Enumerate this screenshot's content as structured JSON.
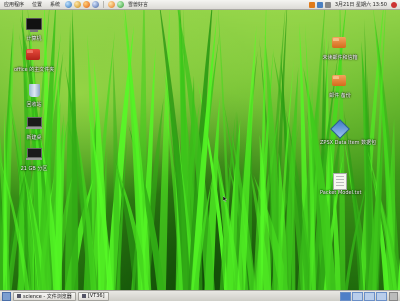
{
  "top_panel": {
    "menus": [
      "应用程序",
      "位置",
      "系统"
    ],
    "center_text": "雪兽好言",
    "clock": "3月21日 星期六 13:50",
    "launcher_icons": [
      "globe-icon",
      "mail-icon",
      "firefox-icon",
      "help-icon"
    ]
  },
  "desktop": {
    "icons_left": [
      {
        "name": "computer-icon",
        "label": "计算机"
      },
      {
        "name": "folder-icon",
        "label": "office 的主文件夹"
      },
      {
        "name": "trash-icon",
        "label": "回收站"
      },
      {
        "name": "laptop-icon",
        "label": "新建桌"
      },
      {
        "name": "laptop-icon",
        "label": "21 GB 分区"
      }
    ],
    "icons_right": [
      {
        "name": "folder-icon",
        "label": "未读邮件和信箱"
      },
      {
        "name": "folder-icon",
        "label": "邮件 备份"
      },
      {
        "name": "package-icon",
        "label": "ZPSX  Data  Item  数据包"
      },
      {
        "name": "document-icon",
        "label": "Packet Model.txt"
      }
    ]
  },
  "bottom_panel": {
    "tasks": [
      {
        "label": "science - 文件浏览器"
      },
      {
        "label": "[VT36]"
      }
    ],
    "workspace_count": 4,
    "active_workspace": 1
  },
  "colors": {
    "panel": "#e3e2dd",
    "grass_light": "#8fd048",
    "grass_dark": "#1f6a0c",
    "workspace_active": "#4f7fc7"
  }
}
